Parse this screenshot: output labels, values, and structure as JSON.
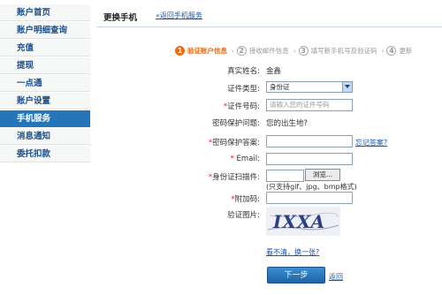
{
  "sidebar": {
    "items": [
      {
        "label": "账户首页"
      },
      {
        "label": "账户明细查询"
      },
      {
        "label": "充值"
      },
      {
        "label": "提现"
      },
      {
        "label": "一点通"
      },
      {
        "label": "账户设置"
      },
      {
        "label": "手机服务"
      },
      {
        "label": "消息通知"
      },
      {
        "label": "委托扣款"
      }
    ],
    "active_index": 6
  },
  "header": {
    "title": "更换手机",
    "back_link": "«返回手机服务"
  },
  "steps": [
    {
      "num": "1",
      "label": "验证账户信息",
      "active": true
    },
    {
      "num": "2",
      "label": "接收邮件信息",
      "active": false
    },
    {
      "num": "3",
      "label": "填写新手机号及验证码",
      "active": false
    },
    {
      "num": "4",
      "label": "更新",
      "active": false
    }
  ],
  "form": {
    "real_name_label": "真实姓名:",
    "real_name_value": "金鑫",
    "id_type_label": "证件类型:",
    "id_type_value": "身份证",
    "id_number_label": "*证件号码:",
    "id_number_placeholder": "请输入您的证件号码",
    "question_label": "密码保护问题:",
    "question_value": "您的出生地?",
    "answer_label": "*密码保护答案:",
    "forgot_answer_link": "忘记答案?",
    "email_label": "* Email:",
    "id_scan_label": "*身份证扫描件:",
    "browse_label": "浏览...",
    "file_hint": "(只支持gif、jpg、bmp格式)",
    "extra_code_label": "*附加码:",
    "captcha_label": "验证图片:",
    "captcha_text": "IXXA",
    "refresh_link": "看不清，换一张?",
    "next_button": "下一步",
    "back_button": "返回"
  },
  "colors": {
    "sidebar_active": "#2476b8",
    "step_active": "#f06a12",
    "link": "#1a57a8"
  }
}
